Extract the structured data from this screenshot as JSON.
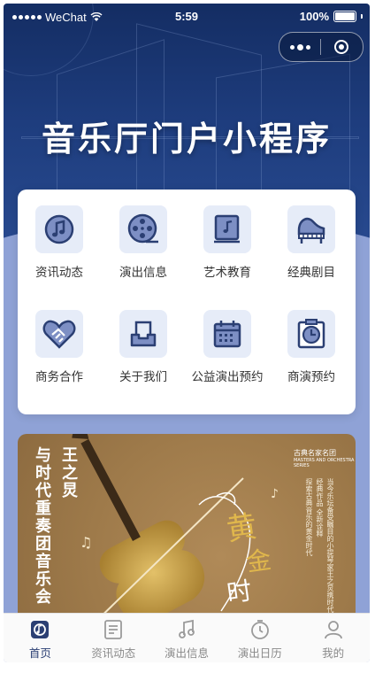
{
  "status_bar": {
    "carrier": "WeChat",
    "time": "5:59",
    "battery": "100%"
  },
  "header": {
    "title": "音乐厅门户小程序",
    "capsule_icons": [
      "more-dots-icon",
      "close-circle-icon"
    ]
  },
  "menu": {
    "items": [
      {
        "label": "资讯动态",
        "icon": "news-icon"
      },
      {
        "label": "演出信息",
        "icon": "film-reel-icon"
      },
      {
        "label": "艺术教育",
        "icon": "music-book-icon"
      },
      {
        "label": "经典剧目",
        "icon": "piano-icon"
      },
      {
        "label": "商务合作",
        "icon": "handshake-heart-icon"
      },
      {
        "label": "关于我们",
        "icon": "inbox-icon"
      },
      {
        "label": "公益演出预约",
        "icon": "calendar-icon"
      },
      {
        "label": "商演预约",
        "icon": "clock-icon"
      }
    ]
  },
  "banner": {
    "name": "王之炅",
    "concert_title": "与时代重奏团音乐会",
    "script_title": "黄金时代",
    "logo_text": "古典名家名团",
    "logo_sub": "MASTERS AND ORCHESTRA SERIES",
    "desc_lines": [
      "当今乐坛备受瞩目的小提琴家王之炅携时代",
      "经典作品 全新诠释",
      "探索古典音乐的黄金时代"
    ]
  },
  "tabbar": {
    "items": [
      {
        "label": "首页",
        "icon": "home-icon",
        "active": true
      },
      {
        "label": "资讯动态",
        "icon": "document-icon",
        "active": false
      },
      {
        "label": "演出信息",
        "icon": "music-note-icon",
        "active": false
      },
      {
        "label": "演出日历",
        "icon": "calendar-dial-icon",
        "active": false
      },
      {
        "label": "我的",
        "icon": "user-icon",
        "active": false
      }
    ]
  },
  "colors": {
    "primary": "#2b3f73",
    "hero_dark": "#142d63",
    "page_bg": "#8fa2d6",
    "icon_bg": "#e6ecf8",
    "tab_inactive": "#8a8a8a",
    "banner_gold": "#b08a58"
  }
}
